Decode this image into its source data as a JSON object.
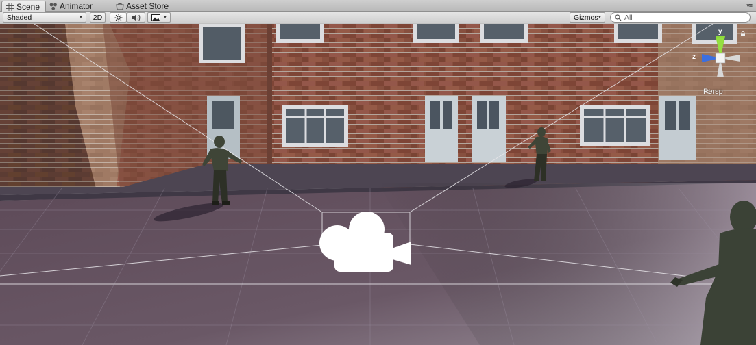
{
  "tabs": [
    {
      "label": "Scene",
      "icon": "grid-icon",
      "active": true
    },
    {
      "label": "Animator",
      "icon": "animator-icon",
      "active": false
    },
    {
      "label": "Asset Store",
      "icon": "store-icon",
      "active": false
    }
  ],
  "toolbar": {
    "shading_mode": "Shaded",
    "mode_2d": "2D",
    "gizmos_label": "Gizmos",
    "search_placeholder": "All"
  },
  "gizmo": {
    "projection_label": "Persp",
    "axis_y": "y",
    "axis_z": "z"
  },
  "colors": {
    "ground": "#5e4c5a",
    "brick": "#7a4a3c",
    "gizmo_y": "#8fdc3a",
    "gizmo_z": "#3b6fe0",
    "camera_icon": "#ffffff"
  }
}
